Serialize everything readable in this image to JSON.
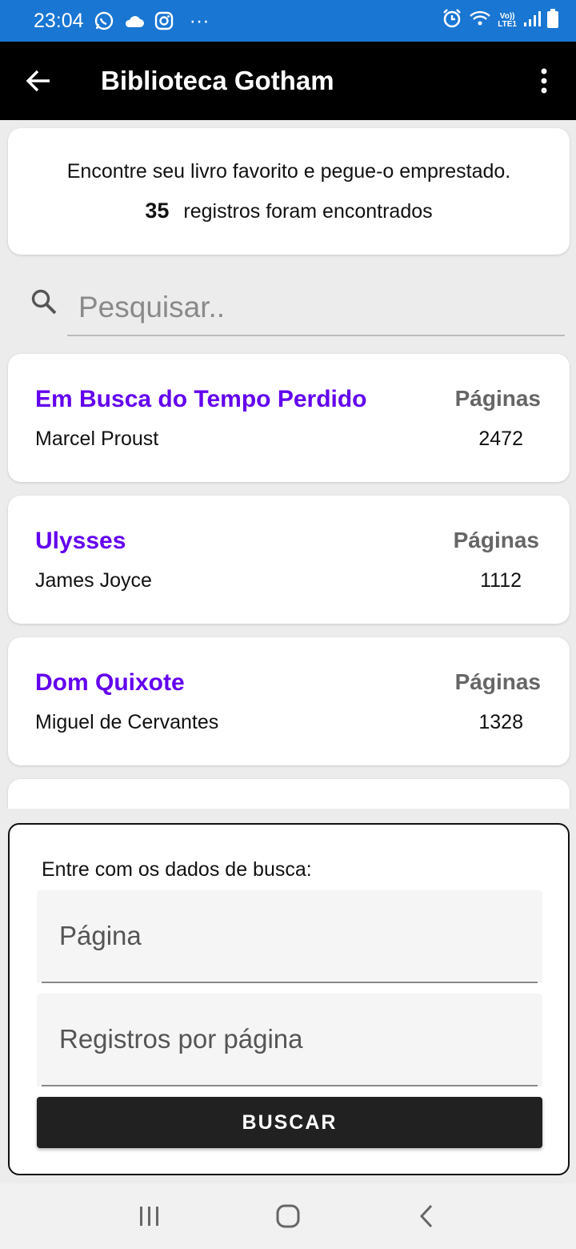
{
  "status_bar": {
    "time": "23:04",
    "more": "···",
    "network_top": "Vo))",
    "network_bottom": "LTE1",
    "icons": [
      "whatsapp-icon",
      "cloud-icon",
      "instagram-icon",
      "alarm-icon",
      "wifi-icon",
      "signal-icon",
      "battery-icon"
    ]
  },
  "app_bar": {
    "title": "Biblioteca Gotham",
    "back_icon": "arrow-left-icon",
    "menu_icon": "more-vert-icon"
  },
  "info_card": {
    "message": "Encontre seu livro favorito e pegue-o emprestado.",
    "count": "35",
    "count_suffix": "registros foram encontrados"
  },
  "search": {
    "placeholder": "Pesquisar..",
    "icon": "search-icon"
  },
  "books": [
    {
      "title": "Em Busca do Tempo Perdido",
      "author": "Marcel Proust",
      "pages_label": "Páginas",
      "pages": "2472"
    },
    {
      "title": "Ulysses",
      "author": "James Joyce",
      "pages_label": "Páginas",
      "pages": "1112"
    },
    {
      "title": "Dom Quixote",
      "author": "Miguel de Cervantes",
      "pages_label": "Páginas",
      "pages": "1328"
    }
  ],
  "search_panel": {
    "label": "Entre com os dados de busca:",
    "page_field_label": "Página",
    "per_page_field_label": "Registros por página",
    "button_label": "BUSCAR"
  },
  "nav_bar": {
    "icons": [
      "recent-apps-icon",
      "home-icon",
      "back-nav-icon"
    ]
  },
  "colors": {
    "status_bar": "#1976d2",
    "app_bar": "#000000",
    "book_title": "#6200ee",
    "button": "#212121"
  }
}
